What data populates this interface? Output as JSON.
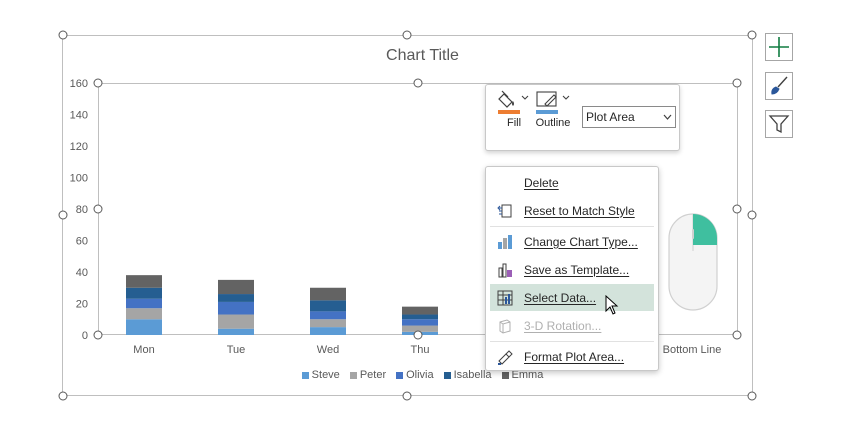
{
  "chart": {
    "title": "Chart Title",
    "partial_axis_label": "Bottom Line"
  },
  "chart_data": {
    "type": "bar",
    "stacked": true,
    "title": "Chart Title",
    "categories": [
      "Mon",
      "Tue",
      "Wed",
      "Thu"
    ],
    "ylim": [
      0,
      160
    ],
    "yticks": [
      0,
      20,
      40,
      60,
      80,
      100,
      120,
      140,
      160
    ],
    "series": [
      {
        "name": "Steve",
        "color": "#5b9bd5",
        "values": [
          10,
          4,
          5,
          2
        ]
      },
      {
        "name": "Peter",
        "color": "#a5a5a5",
        "values": [
          7,
          9,
          5,
          4
        ]
      },
      {
        "name": "Olivia",
        "color": "#4472c4",
        "values": [
          6,
          8,
          5,
          4
        ]
      },
      {
        "name": "Isabella",
        "color": "#255e91",
        "values": [
          7,
          5,
          7,
          3
        ]
      },
      {
        "name": "Emma",
        "color": "#636363",
        "values": [
          8,
          9,
          8,
          5
        ]
      }
    ],
    "grid": false,
    "legend": "bottom"
  },
  "format_toolbar": {
    "fill_label": "Fill",
    "outline_label": "Outline",
    "area_select_value": "Plot Area",
    "fill_color": "#ed7d31",
    "outline_color": "#5b9bd5"
  },
  "context_menu": {
    "items": [
      {
        "label": "Delete",
        "icon": "none",
        "state": "normal"
      },
      {
        "label": "Reset to Match Style",
        "icon": "reset-style-icon",
        "state": "normal"
      },
      {
        "label": "Change Chart Type...",
        "icon": "chart-type-icon",
        "state": "normal"
      },
      {
        "label": "Save as Template...",
        "icon": "template-icon",
        "state": "normal"
      },
      {
        "label": "Select Data...",
        "icon": "select-data-icon",
        "state": "highlighted"
      },
      {
        "label": "3-D Rotation...",
        "icon": "rotation-icon",
        "state": "disabled"
      },
      {
        "label": "Format Plot Area...",
        "icon": "format-area-icon",
        "state": "normal"
      }
    ]
  },
  "side_buttons": [
    {
      "icon": "plus-icon",
      "color": "#107c41"
    },
    {
      "icon": "brush-icon",
      "color": "#2b579a"
    },
    {
      "icon": "filter-icon",
      "color": "#404040"
    }
  ]
}
